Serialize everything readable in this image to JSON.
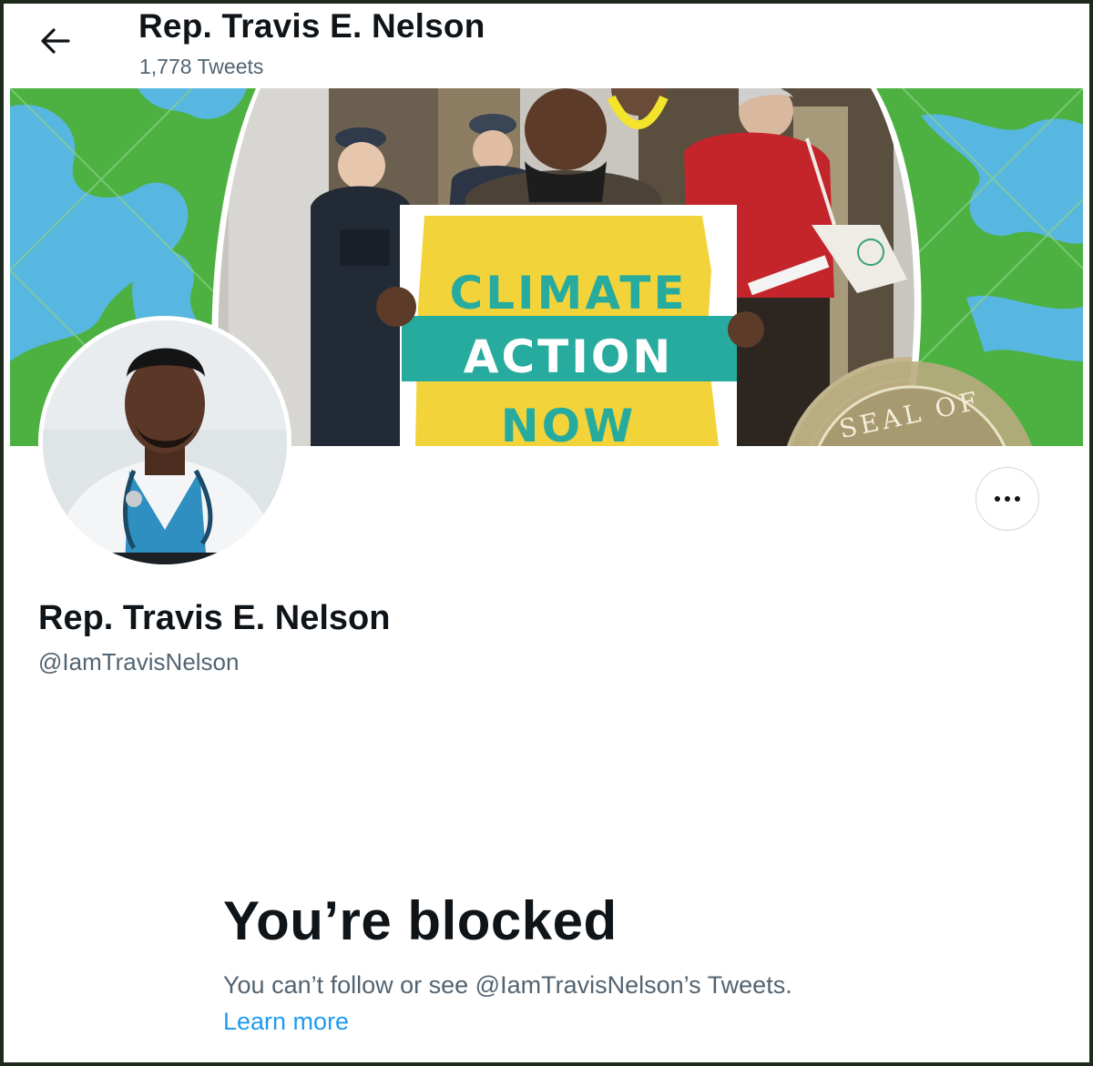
{
  "header": {
    "title": "Rep. Travis E. Nelson",
    "tweet_count": "1,778 Tweets",
    "back_icon": "arrow-left-icon"
  },
  "banner": {
    "sign_line1": "CLIMATE",
    "sign_line2": "ACTION",
    "sign_line3": "NOW",
    "seal_text": "SEAL OF"
  },
  "profile": {
    "name": "Rep. Travis E. Nelson",
    "handle": "@IamTravisNelson",
    "more_icon": "more-horizontal-icon"
  },
  "blocked": {
    "title": "You’re blocked",
    "message": "You can’t follow or see @IamTravisNelson’s Tweets.",
    "link": "Learn more"
  },
  "colors": {
    "text_primary": "#0f1419",
    "text_secondary": "#536471",
    "link": "#1d9bf0",
    "banner_green": "#4cb140",
    "banner_blue": "#57b7e0",
    "sign_yellow": "#f2d43a",
    "sign_teal": "#27ab9e"
  }
}
